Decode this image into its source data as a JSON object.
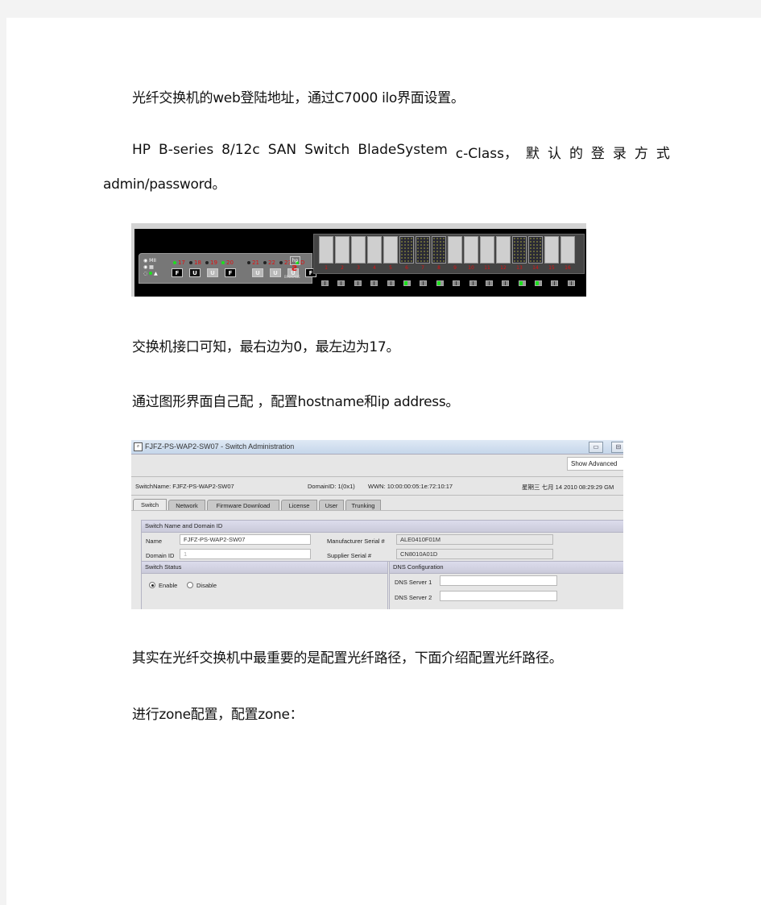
{
  "document": {
    "paragraphs": [
      "光纤交换机的web登陆地址，通过C7000 ilo界面设置。",
      "HP B-series 8/12c SAN Switch BladeSystem c-Class，默认的登录方式",
      "admin/password。",
      "交换机接口可知，最右边为0，最左边为17。",
      "通过图形界面自己配 ，配置hostname和ip address。",
      "其实在光纤交换机中最重要的是配置光纤路径，下面介绍配置光纤路径。",
      "进行zone配置，配置zone："
    ],
    "justified_line_words": [
      "HP",
      "B-series",
      "8/12c",
      "SAN",
      "Switch",
      "BladeSystem",
      "c-Class，",
      "默",
      "认",
      "的",
      "登",
      "录",
      "方",
      "式"
    ]
  },
  "switch_panel": {
    "status_icons": [
      "MII",
      "fan",
      "warning"
    ],
    "left_ports": [
      {
        "num": "17",
        "led": "green",
        "gbic": "F",
        "gbic_style": "f"
      },
      {
        "num": "18",
        "led": "off",
        "gbic": "U",
        "gbic_style": "u-dark"
      },
      {
        "num": "19",
        "led": "off",
        "gbic": "U",
        "gbic_style": "u-light"
      },
      {
        "num": "20",
        "led": "green",
        "gbic": "F",
        "gbic_style": "f"
      },
      {
        "num": "21",
        "led": "off",
        "gbic": "U",
        "gbic_style": "u-light"
      },
      {
        "num": "22",
        "led": "off",
        "gbic": "U",
        "gbic_style": "u-light"
      },
      {
        "num": "23",
        "led": "off",
        "gbic": "U",
        "gbic_style": "u-light"
      },
      {
        "num": "D",
        "led": "green",
        "gbic": "F",
        "gbic_style": "f"
      }
    ],
    "hp_logo": "hp",
    "brand": "BROCADE",
    "bays": [
      {
        "num": "1",
        "mesh": false,
        "active": false
      },
      {
        "num": "2",
        "mesh": false,
        "active": false
      },
      {
        "num": "3",
        "mesh": false,
        "active": false
      },
      {
        "num": "4",
        "mesh": false,
        "active": false
      },
      {
        "num": "5",
        "mesh": false,
        "active": false
      },
      {
        "num": "6",
        "mesh": true,
        "active": true
      },
      {
        "num": "7",
        "mesh": true,
        "active": false
      },
      {
        "num": "8",
        "mesh": true,
        "active": true
      },
      {
        "num": "9",
        "mesh": false,
        "active": false
      },
      {
        "num": "10",
        "mesh": false,
        "active": false
      },
      {
        "num": "11",
        "mesh": false,
        "active": false
      },
      {
        "num": "12",
        "mesh": false,
        "active": false
      },
      {
        "num": "13",
        "mesh": true,
        "active": true
      },
      {
        "num": "14",
        "mesh": true,
        "active": true
      },
      {
        "num": "15",
        "mesh": false,
        "active": false
      },
      {
        "num": "16",
        "mesh": false,
        "active": false
      }
    ]
  },
  "admin_window": {
    "title": "FJFZ-PS-WAP2-SW07 - Switch Administration",
    "minimize_label": "▭",
    "restore_label": "⊟",
    "show_advanced": "Show Advanced",
    "info": {
      "switch_name": "SwitchName: FJFZ-PS-WAP2-SW07",
      "domain_id": "DomainID: 1(0x1)",
      "wwn": "WWN: 10:00:00:05:1e:72:10:17",
      "datetime": "星期三 七月 14 2010 08:29:29 GM"
    },
    "tabs": [
      "Switch",
      "Network",
      "Firmware Download",
      "License",
      "User",
      "Trunking"
    ],
    "active_tab": "Switch",
    "name_domain_group": {
      "title": "Switch Name and Domain ID",
      "name_label": "Name",
      "name_value": "FJFZ-PS-WAP2-SW07",
      "domain_label": "Domain ID",
      "domain_value": "1",
      "mfr_serial_label": "Manufacturer Serial #",
      "mfr_serial_value": "ALE0410F01M",
      "supplier_serial_label": "Supplier Serial #",
      "supplier_serial_value": "CN8010A01D"
    },
    "switch_status": {
      "title": "Switch Status",
      "options": [
        "Enable",
        "Disable"
      ],
      "selected": "Enable"
    },
    "dns": {
      "title": "DNS Configuration",
      "server1_label": "DNS Server 1",
      "server1_value": "",
      "server2_label": "DNS Server 2",
      "server2_value": ""
    }
  }
}
